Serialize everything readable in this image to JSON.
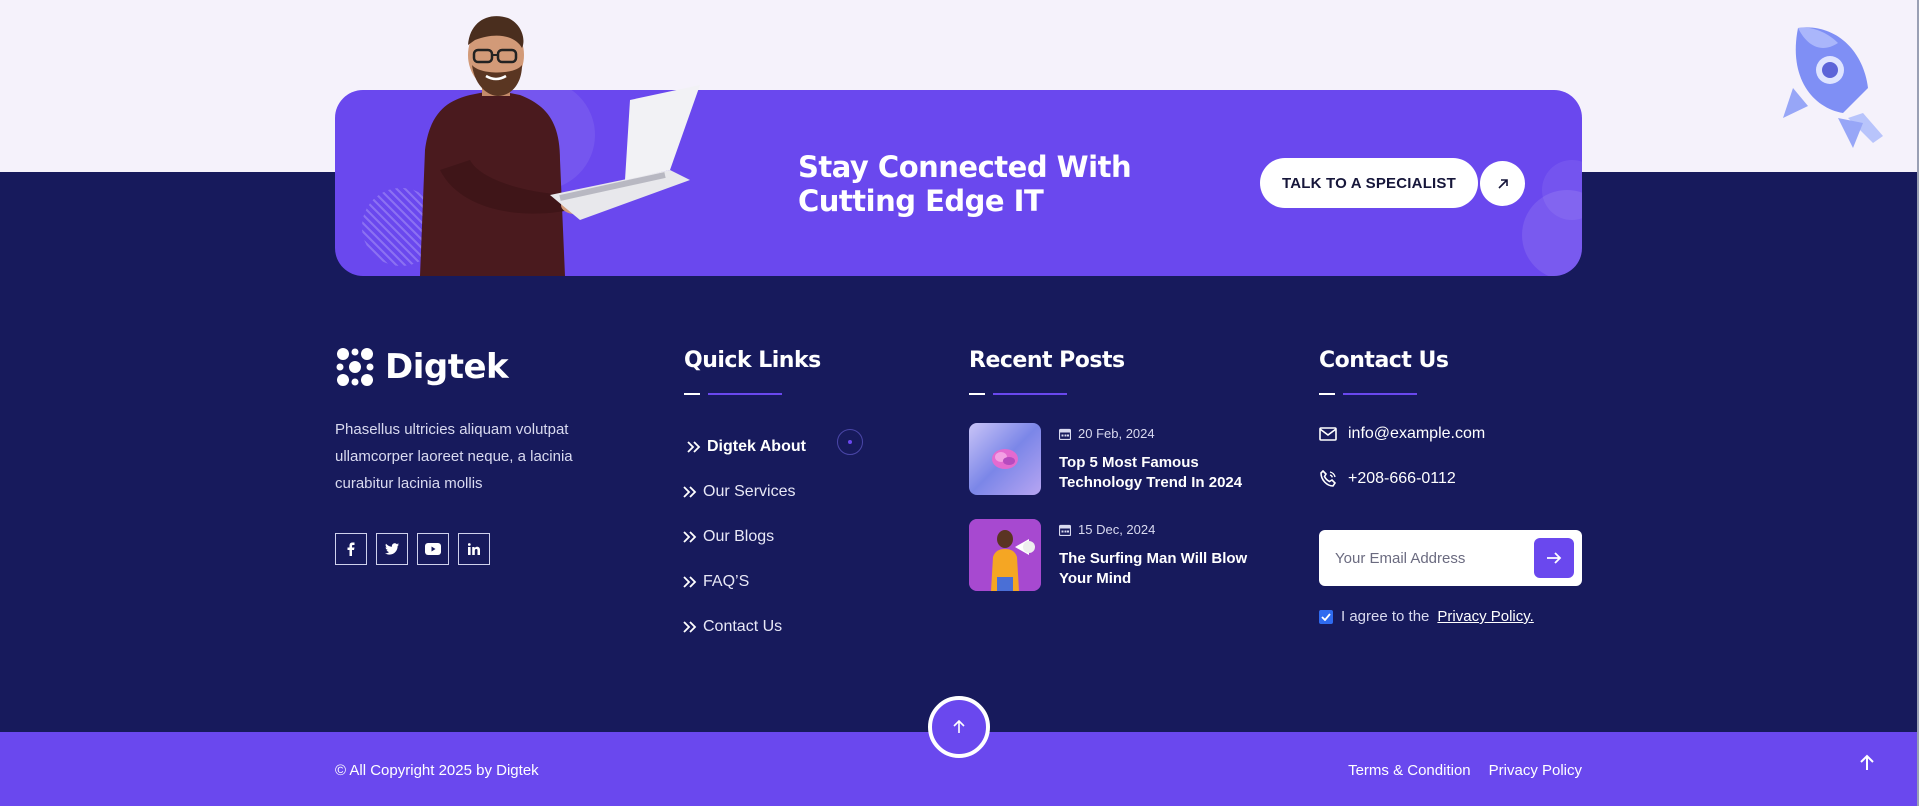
{
  "cta": {
    "title": "Stay Connected With Cutting Edge IT",
    "button_label": "TALK TO A SPECIALIST"
  },
  "brand": {
    "name": "Digtek",
    "description": "Phasellus ultricies aliquam volutpat ullamcorper laoreet neque, a lacinia curabitur lacinia mollis",
    "socials": [
      {
        "name": "facebook-icon",
        "glyph": "f"
      },
      {
        "name": "twitter-icon",
        "glyph": "t"
      },
      {
        "name": "youtube-icon",
        "glyph": "yt"
      },
      {
        "name": "linkedin-icon",
        "glyph": "in"
      }
    ]
  },
  "quick_links": {
    "title": "Quick Links",
    "items": [
      {
        "label": "Digtek About"
      },
      {
        "label": "Our Services"
      },
      {
        "label": "Our Blogs"
      },
      {
        "label": "FAQ’S"
      },
      {
        "label": "Contact Us"
      }
    ]
  },
  "recent_posts": {
    "title": "Recent Posts",
    "items": [
      {
        "date": "20 Feb, 2024",
        "title": "Top 5 Most Famous Technology Trend In 2024"
      },
      {
        "date": "15 Dec, 2024",
        "title": "The Surfing Man Will Blow Your Mind"
      }
    ]
  },
  "contact": {
    "title": "Contact Us",
    "email": "info@example.com",
    "phone": "+208-666-0112",
    "email_placeholder": "Your Email Address",
    "agree_text": "I agree to the",
    "privacy_link": "Privacy Policy."
  },
  "footer": {
    "copyright": "© All Copyright 2025 by Digtek",
    "links": [
      "Terms & Condition",
      "Privacy Policy"
    ]
  },
  "colors": {
    "accent": "#6a48ee",
    "navy": "#171a5c",
    "light_band": "#f5f2fb"
  }
}
